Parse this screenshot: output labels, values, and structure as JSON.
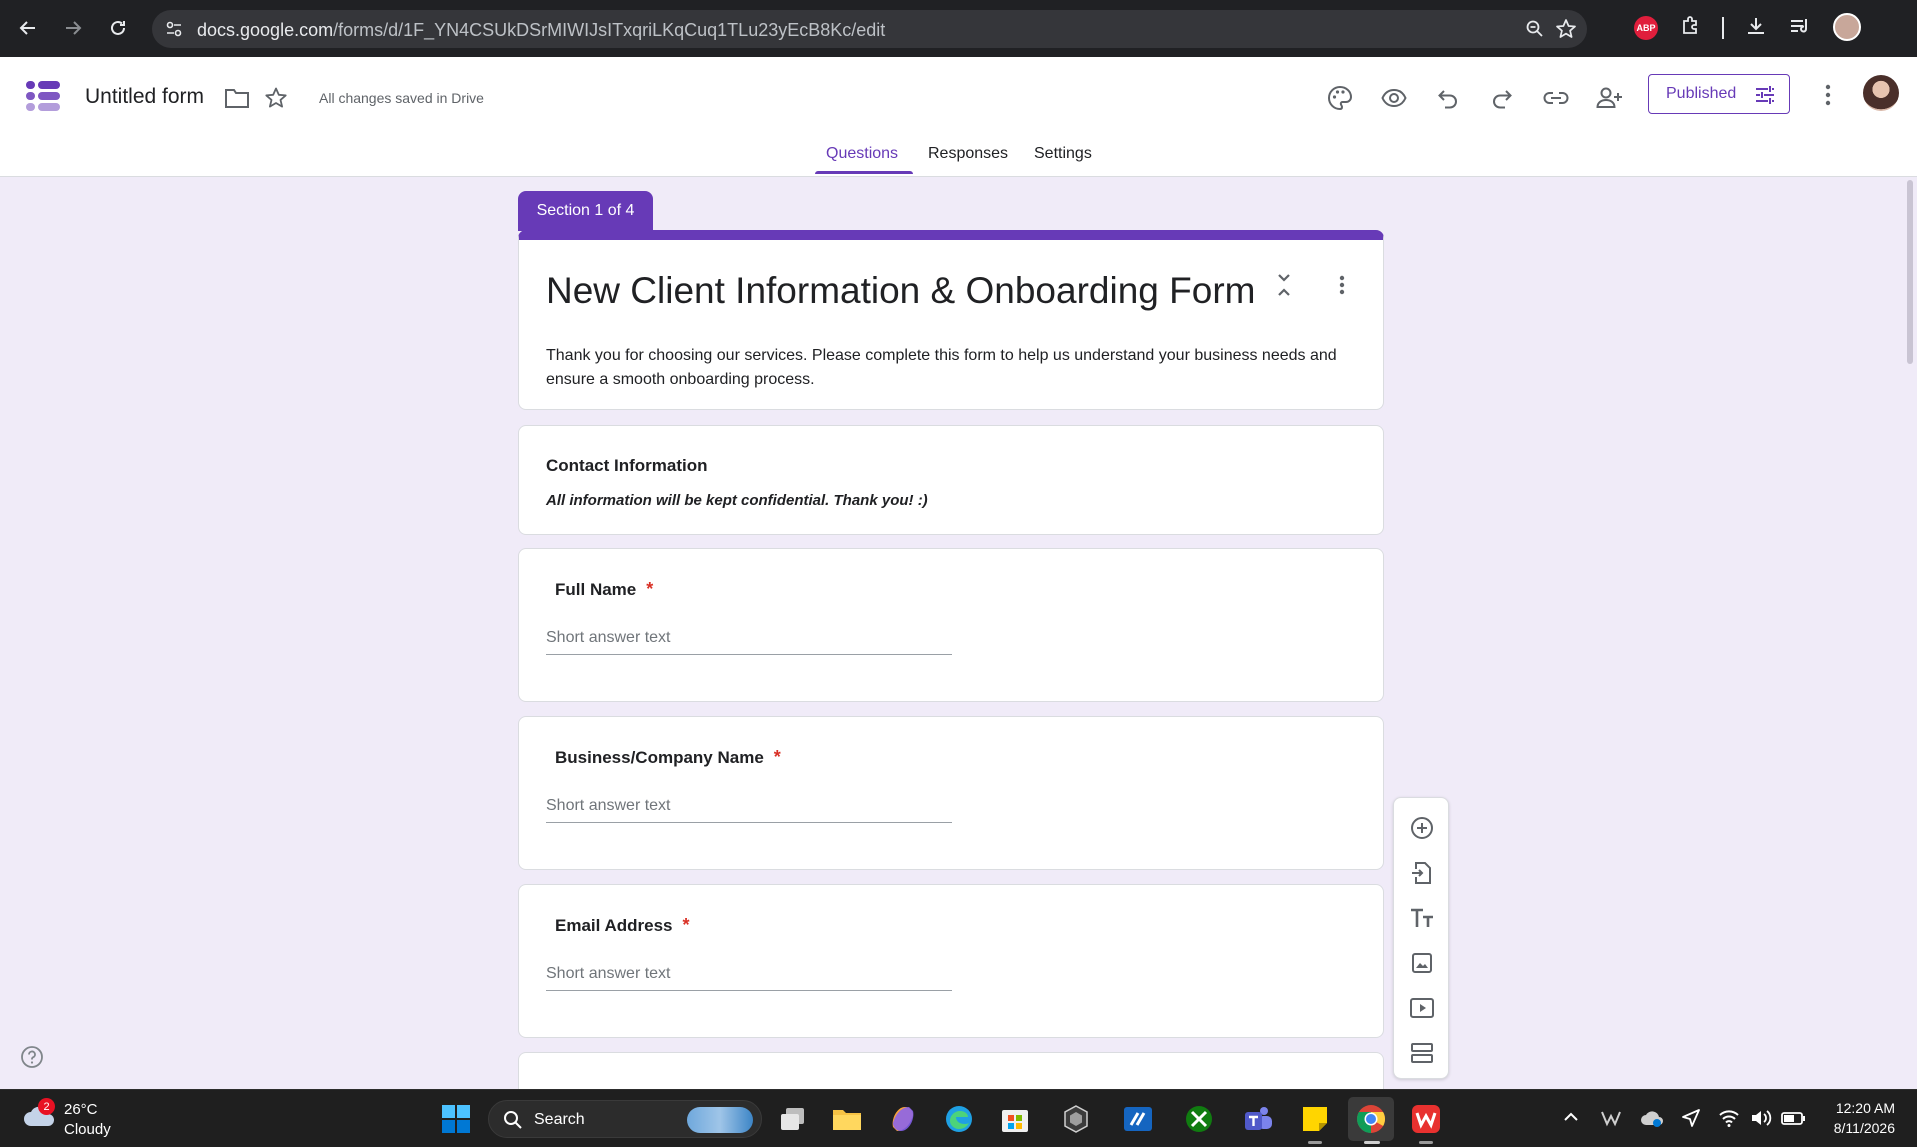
{
  "browser": {
    "url_host": "docs.google.com",
    "url_path": "/forms/d/1F_YN4CSUkDSrMIWIJsITxqriLKqCuq1TLu23yEcB8Kc/edit",
    "abp_label": "ABP"
  },
  "header": {
    "doc_title": "Untitled form",
    "saved_status": "All changes saved in Drive",
    "published_label": "Published"
  },
  "tabs": [
    {
      "label": "Questions"
    },
    {
      "label": "Responses"
    },
    {
      "label": "Settings"
    }
  ],
  "form": {
    "section_label": "Section 1 of 4",
    "title": "New Client Information & Onboarding Form",
    "description": "Thank you for choosing our services. Please complete this form to help us understand your business needs and ensure a smooth onboarding process."
  },
  "section": {
    "title": "Contact Information",
    "description": "All information will be kept confidential. Thank you! :)"
  },
  "questions": [
    {
      "label": "Full Name",
      "required_mark": "*",
      "placeholder": "Short answer text"
    },
    {
      "label": "Business/Company Name",
      "required_mark": "*",
      "placeholder": "Short answer text"
    },
    {
      "label": "Email Address",
      "required_mark": "*",
      "placeholder": "Short answer text"
    }
  ],
  "taskbar": {
    "weather_badge": "2",
    "temperature": "26°C",
    "condition": "Cloudy",
    "search_label": "Search",
    "time": "12:20 AM",
    "date": "8/11/2026"
  },
  "colors": {
    "accent": "#673ab7",
    "background": "#f0ebf8",
    "required": "#d93025"
  }
}
